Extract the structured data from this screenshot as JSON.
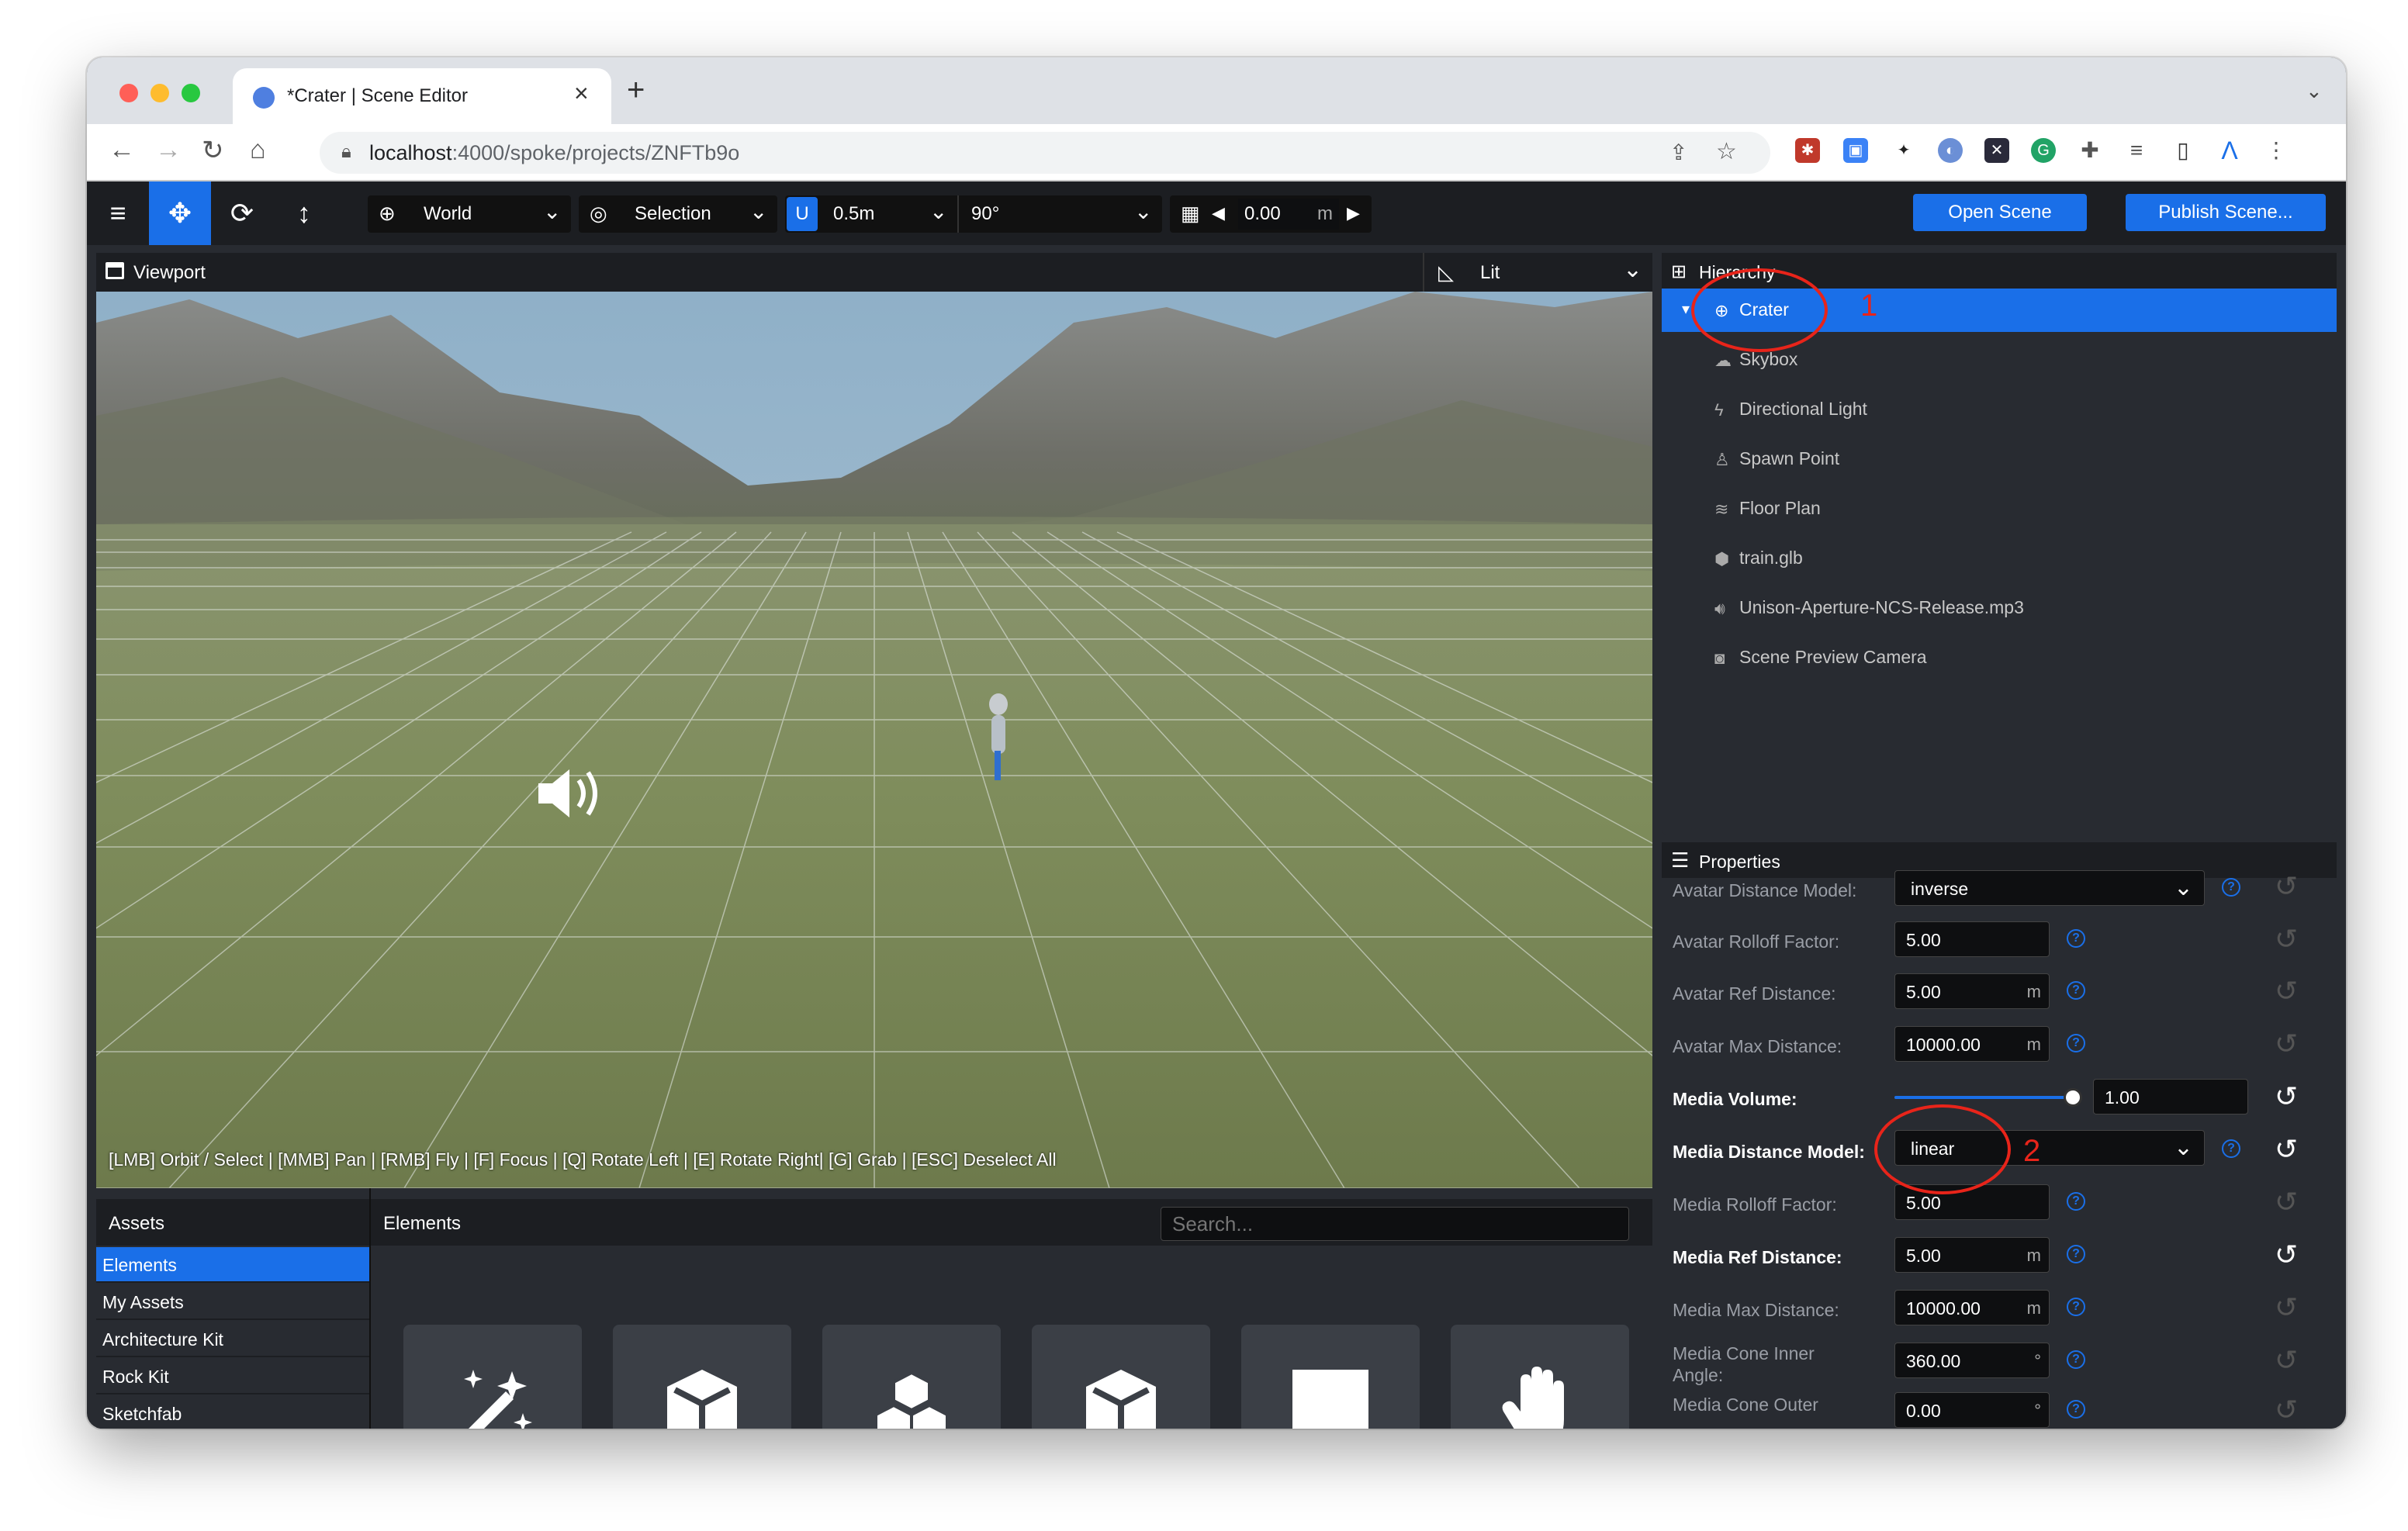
{
  "browser": {
    "tab_title": "*Crater | Scene Editor",
    "url_host": "localhost",
    "url_path": ":4000/spoke/projects/ZNFTb9o"
  },
  "toolbar": {
    "space": "World",
    "pivot": "Selection",
    "snap_translate": "0.5m",
    "snap_rotate": "90°",
    "grid_height": "0.00",
    "grid_unit": "m",
    "open_scene": "Open Scene",
    "publish_scene": "Publish Scene..."
  },
  "viewport": {
    "title": "Viewport",
    "render_mode": "Lit",
    "help_text": "[LMB] Orbit / Select | [MMB] Pan | [RMB] Fly | [F] Focus | [Q] Rotate Left | [E] Rotate Right| [G] Grab | [ESC] Deselect All"
  },
  "assets": {
    "title": "Assets",
    "elements_title": "Elements",
    "search_placeholder": "Search...",
    "sources": [
      {
        "label": "Elements",
        "selected": true
      },
      {
        "label": "My Assets"
      },
      {
        "label": "Architecture Kit"
      },
      {
        "label": "Rock Kit"
      },
      {
        "label": "Sketchfab"
      }
    ],
    "tiles": [
      "magic-wand-icon",
      "cube-icon",
      "cubes-icon",
      "cube-icon",
      "square-icon",
      "hand-icon"
    ]
  },
  "hierarchy": {
    "title": "Hierarchy",
    "items": [
      {
        "label": "Crater",
        "icon": "globe-icon",
        "selected": true
      },
      {
        "label": "Skybox",
        "icon": "cloud-icon"
      },
      {
        "label": "Directional Light",
        "icon": "bolt-icon"
      },
      {
        "label": "Spawn Point",
        "icon": "street-view-icon"
      },
      {
        "label": "Floor Plan",
        "icon": "shoe-prints-icon"
      },
      {
        "label": "train.glb",
        "icon": "cube-icon"
      },
      {
        "label": "Unison-Aperture-NCS-Release.mp3",
        "icon": "volume-icon"
      },
      {
        "label": "Scene Preview Camera",
        "icon": "camera-icon"
      }
    ]
  },
  "properties": {
    "title": "Properties",
    "rows": [
      {
        "label": "Avatar Distance Model:",
        "type": "select",
        "value": "inverse"
      },
      {
        "label": "Avatar Rolloff Factor:",
        "type": "input",
        "value": "5.00",
        "unit": ""
      },
      {
        "label": "Avatar Ref Distance:",
        "type": "input",
        "value": "5.00",
        "unit": "m"
      },
      {
        "label": "Avatar Max Distance:",
        "type": "input",
        "value": "10000.00",
        "unit": "m"
      },
      {
        "label": "Media Volume:",
        "type": "slider",
        "value": "1.00",
        "level": 1.0,
        "bold": true
      },
      {
        "label": "Media Distance Model:",
        "type": "select",
        "value": "linear",
        "bold": true
      },
      {
        "label": "Media Rolloff Factor:",
        "type": "input",
        "value": "5.00",
        "unit": ""
      },
      {
        "label": "Media Ref Distance:",
        "type": "input",
        "value": "5.00",
        "unit": "m",
        "bold": true
      },
      {
        "label": "Media Max Distance:",
        "type": "input",
        "value": "10000.00",
        "unit": "m"
      },
      {
        "label": "Media Cone Inner Angle:",
        "type": "input",
        "value": "360.00",
        "unit": "°"
      },
      {
        "label": "Media Cone Outer",
        "type": "input",
        "value": "0.00",
        "unit": "°"
      }
    ]
  },
  "annotations": [
    "1",
    "2"
  ]
}
